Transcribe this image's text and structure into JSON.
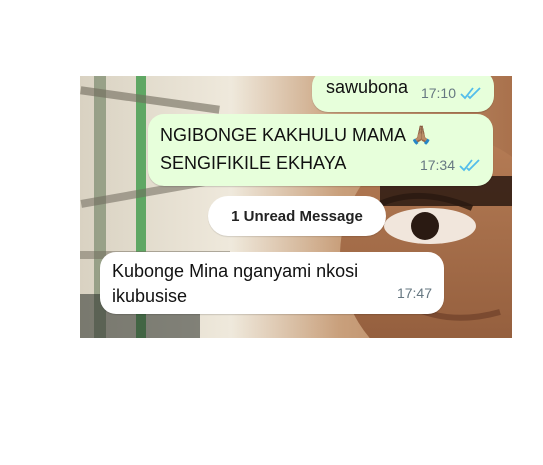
{
  "messages": [
    {
      "direction": "outgoing",
      "text": "sawubona",
      "time": "17:10",
      "status": "read-ticks-icon"
    },
    {
      "direction": "outgoing",
      "text_line1": "NGIBONGE KAKHULU MAMA 🙏🏽",
      "text_line2": "SENGIFIKILE EKHAYA",
      "time": "17:34",
      "status": "read-ticks-icon"
    },
    {
      "direction": "incoming",
      "text_line1": "Kubonge Mina nganyami nkosi",
      "text_line2": "ikubusise",
      "time": "17:47"
    }
  ],
  "unread_divider": {
    "label": "1 Unread Message"
  },
  "colors": {
    "outgoing_bubble": "#e7ffdb",
    "incoming_bubble": "#ffffff",
    "read_ticks": "#53bdeb",
    "timestamp": "#667781"
  }
}
